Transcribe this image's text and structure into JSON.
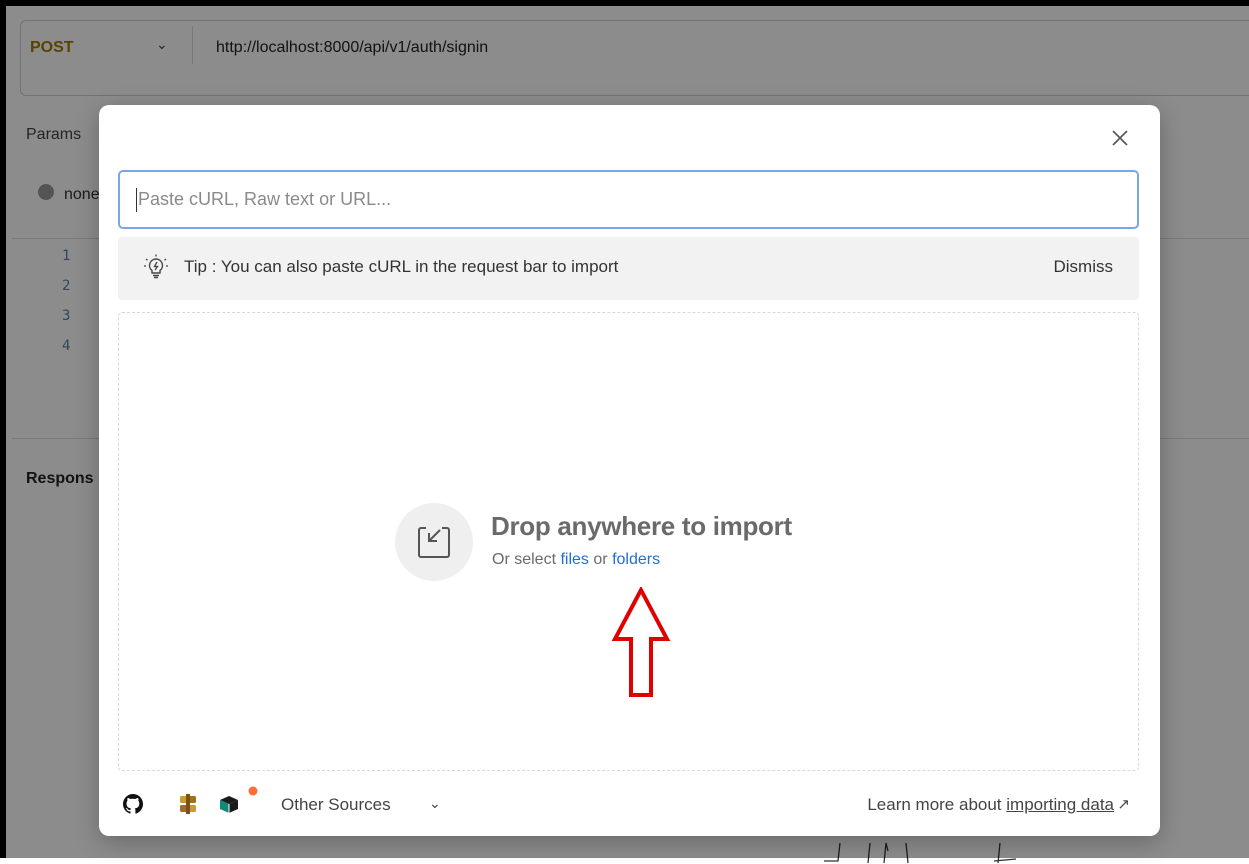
{
  "request": {
    "method": "POST",
    "url": "http://localhost:8000/api/v1/auth/signin",
    "params_tab": "Params",
    "body_option": "none",
    "line_numbers": [
      "1",
      "2",
      "3",
      "4"
    ],
    "response_label": "Respons"
  },
  "modal": {
    "input_placeholder": "Paste cURL, Raw text or URL...",
    "input_value": "",
    "tip_text": "Tip : You can also paste cURL in the request bar to import",
    "dismiss_label": "Dismiss",
    "drop_title": "Drop anywhere to import",
    "drop_or_select": "Or select",
    "files_link": "files",
    "or_word": "or",
    "folders_link": "folders",
    "other_sources": "Other Sources",
    "learn_more": "Learn more about",
    "learn_link": "importing data",
    "source_icons": [
      "github-icon",
      "swagger-hub-icon",
      "api-gateway-icon"
    ]
  },
  "colors": {
    "accent": "#1f6fd6",
    "method": "#a07a00",
    "annotation_arrow": "#e00000",
    "notification_dot": "#ff6d3b"
  }
}
